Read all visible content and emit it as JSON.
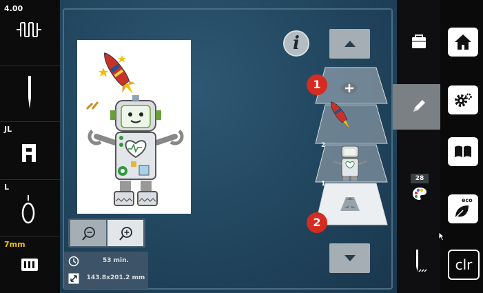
{
  "left_sidebar": {
    "stitch_width": "4.00",
    "presser_foot": "JL",
    "stitch_plate": "L",
    "needle_size": "7mm"
  },
  "canvas": {
    "layers": [
      "2",
      "1"
    ],
    "badge_1": "1",
    "badge_2": "2"
  },
  "info": {
    "time": "53 min.",
    "size": "143.8x201.2 mm"
  },
  "right_panel": {
    "color_count": "28"
  },
  "right_sidebar": {
    "clear_label": "clr",
    "eco_label": "eco"
  },
  "icons": [
    "stitch-width-icon",
    "needle-icon",
    "presser-foot-icon",
    "stitch-plate-icon",
    "hoop-icon",
    "info-icon",
    "zoom-out-icon",
    "zoom-in-icon",
    "clock-icon",
    "resize-icon",
    "folder-icon",
    "pencil-icon",
    "palette-icon",
    "needle-stitch-icon",
    "home-icon",
    "gear-icon",
    "book-icon",
    "eco-leaf-icon"
  ],
  "colors": {
    "accent_yellow": "#f2c200",
    "badge_red": "#d62b20",
    "panel_gray": "#7a8084"
  }
}
